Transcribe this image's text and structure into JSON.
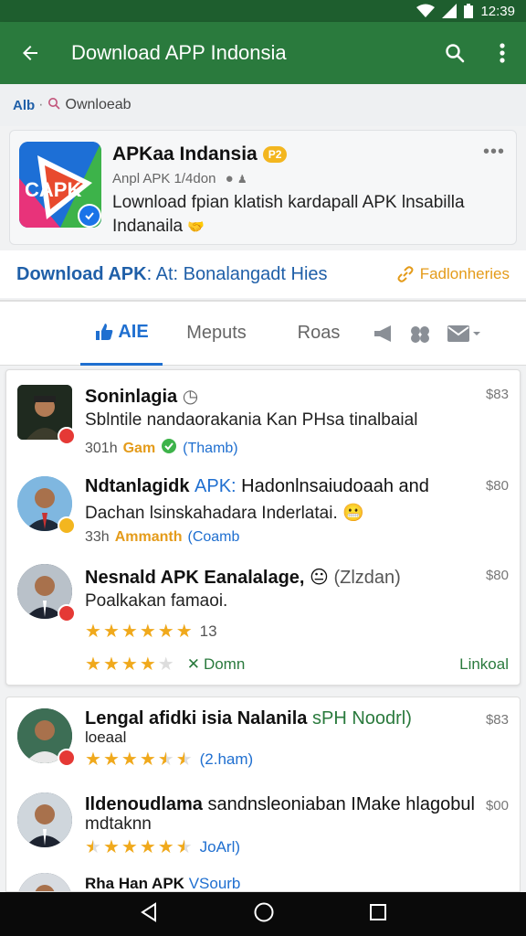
{
  "status": {
    "time": "12:39"
  },
  "app_bar": {
    "title": "Download APP Indonsia"
  },
  "breadcrumb": {
    "root": "Alb",
    "current": "Ownloeab"
  },
  "app": {
    "name": "APKaa Indansia",
    "badge": "P2",
    "sub": "Anpl APK 1/4don",
    "description": "Lownload fpian klatish kardapall APK lnsabilla Indanaila",
    "logo_text": "CAPK"
  },
  "download": {
    "label": "Download APK",
    "rest": ": At: Bonalangadt Hies",
    "side": "Fadlonheries"
  },
  "tabs": {
    "t1": "AIE",
    "t2": "Meputs",
    "t3": "Roas"
  },
  "comments": [
    {
      "title": "Soninlagia",
      "body": "Sblntile nandaorakania Kan PHsa tinalbaial",
      "meta_time": "301h",
      "meta_accent": "Gam",
      "meta_link": "(Thamb)",
      "price": "$83"
    },
    {
      "title": "Ndtanlagidk",
      "extra": "APK:",
      "title_rest": "Hadonlnsaiudoaah and",
      "body": "Dachan lsinskahadara Inderlatai.",
      "meta_time": "33h",
      "meta_accent": "Ammanth",
      "meta_link": "(Coamb",
      "price": "$80"
    },
    {
      "title": "Nesnald APK Eanalalage,",
      "extra": "(Zlzdan)",
      "body": "Poalkakan famaoi.",
      "rating_count": "13",
      "down": "Domn",
      "link_right": "Linkoal",
      "price": "$80"
    },
    {
      "title": "Lengal afidki isia Nalanila",
      "extra": "sPH Noodrl)",
      "body": "loeaal",
      "rating_link": "(2.ham)",
      "price": "$83"
    },
    {
      "title": "Ildenoudlama",
      "title_rest": "sandnsleoniaban IMake hlagobul",
      "body": "mdtaknn",
      "rating_link": "JoArl)",
      "price": "$00"
    },
    {
      "title": "Rha Han APK",
      "extra": "VSourb"
    }
  ],
  "colors": {
    "appbar": "#2a7a3d",
    "status": "#1e5e2e",
    "accent_blue": "#1f6fd0",
    "accent_orange": "#e49b1a"
  }
}
